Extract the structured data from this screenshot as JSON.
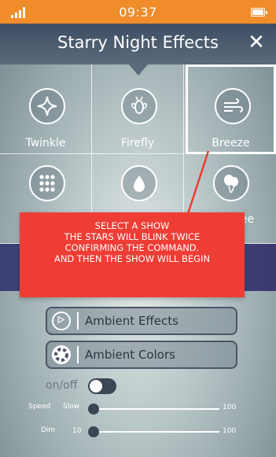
{
  "status_bar": {
    "time": "09:37",
    "background": "#f08c2a"
  },
  "header": {
    "title": "Starry Night Effects",
    "close_glyph": "✕"
  },
  "shows": [
    {
      "label": "Twinkle",
      "icon": "sparkle-icon"
    },
    {
      "label": "Firefly",
      "icon": "firefly-icon"
    },
    {
      "label": "Breeze",
      "icon": "wind-icon",
      "selected": true
    },
    {
      "label": "",
      "icon": "dots-grid-icon"
    },
    {
      "label": "",
      "icon": "water-drop-icon"
    },
    {
      "label": "oree",
      "icon": "balloons-icon"
    }
  ],
  "ambient": {
    "effects_label": "Ambient Effects",
    "colors_label": "Ambient Colors"
  },
  "power": {
    "label": "on/off",
    "on": false
  },
  "speed": {
    "label": "Speed",
    "min_label": "Slow",
    "max_label": "100",
    "value": 0
  },
  "dim": {
    "label": "Dim",
    "min_label": "10",
    "max_label": "100",
    "value": 0
  },
  "callout": {
    "lines": [
      "SELECT A SHOW",
      "THE STARS WILL BLINK TWICE",
      "CONFIRMING THE COMMAND.",
      "AND THEN THE SHOW WILL BEGIN"
    ],
    "color": "#ee3d35"
  }
}
